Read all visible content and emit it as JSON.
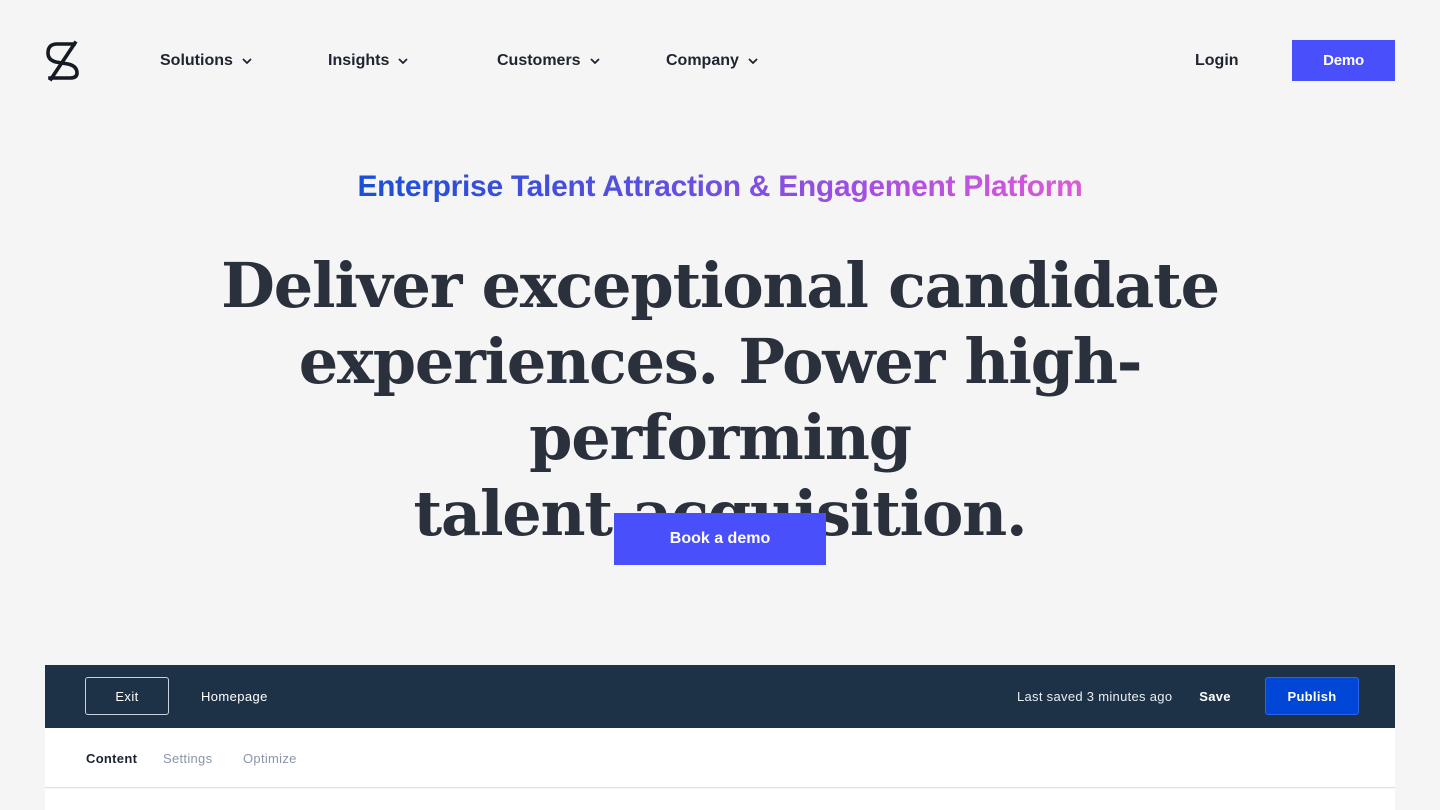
{
  "nav": {
    "items": [
      {
        "label": "Solutions"
      },
      {
        "label": "Insights"
      },
      {
        "label": "Customers"
      },
      {
        "label": "Company"
      }
    ],
    "login_label": "Login",
    "demo_label": "Demo"
  },
  "hero": {
    "eyebrow": "Enterprise Talent Attraction & Engagement Platform",
    "headline_lines": [
      "Deliver exceptional candidate",
      "experiences. Power high-performing",
      "talent acquisition."
    ],
    "cta_label": "Book a demo"
  },
  "editor": {
    "exit_label": "Exit",
    "page_name": "Homepage",
    "saved_status": "Last saved 3 minutes ago",
    "save_label": "Save",
    "publish_label": "Publish",
    "tabs": [
      {
        "label": "Content",
        "active": true
      },
      {
        "label": "Settings",
        "active": false
      },
      {
        "label": "Optimize",
        "active": false
      }
    ]
  },
  "colors": {
    "accent": "#4a4ffc",
    "editor_bar": "#1d3246",
    "publish": "#0047d7",
    "background": "#f4f5f4"
  },
  "icons": {
    "logo": "brand-logo-icon",
    "chevron": "chevron-down-icon"
  }
}
